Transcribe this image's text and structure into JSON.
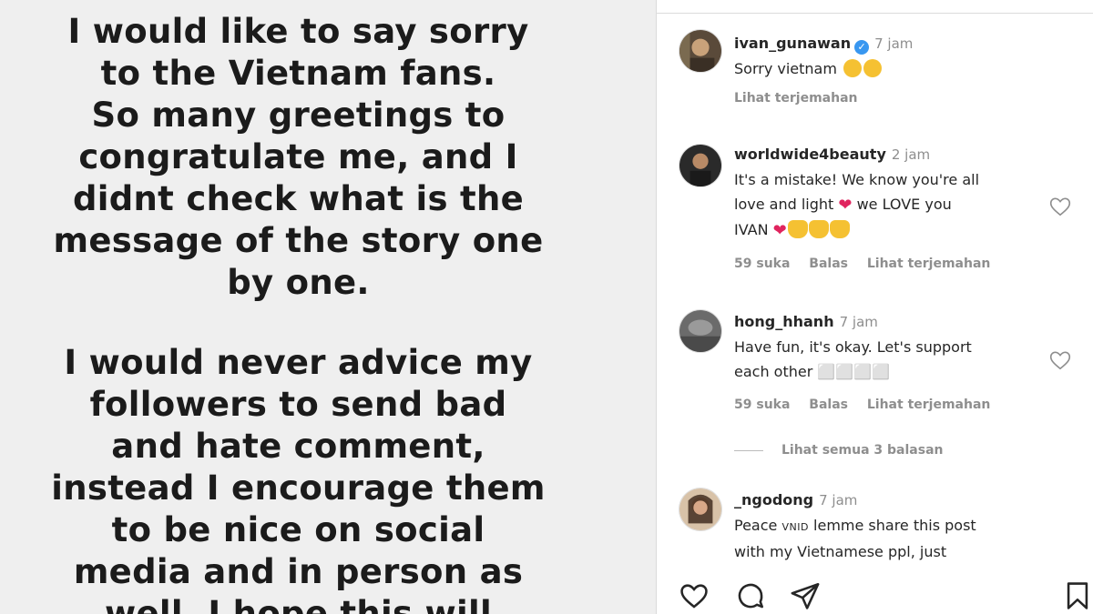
{
  "story": {
    "paragraph1": [
      "I would like to say sorry",
      "to the Vietnam fans.",
      "So many greetings to",
      "congratulate me, and I",
      "didnt check what is the",
      "message of the story one",
      "by one."
    ],
    "paragraph2": [
      "I would never advice my",
      "followers to send bad",
      "and hate comment,",
      "instead I encourage them",
      "to be nice on social",
      "media and in person as",
      "well. I hope this will"
    ]
  },
  "comments": [
    {
      "username": "ivan_gunawan",
      "verified": true,
      "time": "7 jam",
      "text": "Sorry vietnam",
      "translate": "Lihat terjemahan"
    },
    {
      "username": "worldwide4beauty",
      "time": "2 jam",
      "text_line1": "It's a mistake! We know you're all",
      "text_line2a": "love and light",
      "text_line2b": "we LOVE you",
      "text_line3": "IVAN",
      "likes": "59 suka",
      "reply": "Balas",
      "translate": "Lihat terjemahan"
    },
    {
      "username": "hong_hhanh",
      "time": "7 jam",
      "text_line1": "Have fun, it's okay. Let's support",
      "text_line2": "each other ⬜⬜⬜⬜",
      "likes": "59 suka",
      "reply": "Balas",
      "translate": "Lihat terjemahan"
    },
    {
      "username": "_ngodong",
      "time": "7 jam",
      "text_line1a": "Peace",
      "text_line1tag": "VNID",
      "text_line1b": "lemme share this post",
      "text_line2": "with my Vietnamese ppl, just"
    }
  ],
  "view_replies": "Lihat semua 3 balasan",
  "icons": {
    "like": "heart-icon",
    "comment": "comment-icon",
    "share": "share-icon",
    "save": "bookmark-icon"
  },
  "colors": {
    "verified": "#3897f0",
    "heart": "#e0245e",
    "muted": "#8e8e8e"
  }
}
